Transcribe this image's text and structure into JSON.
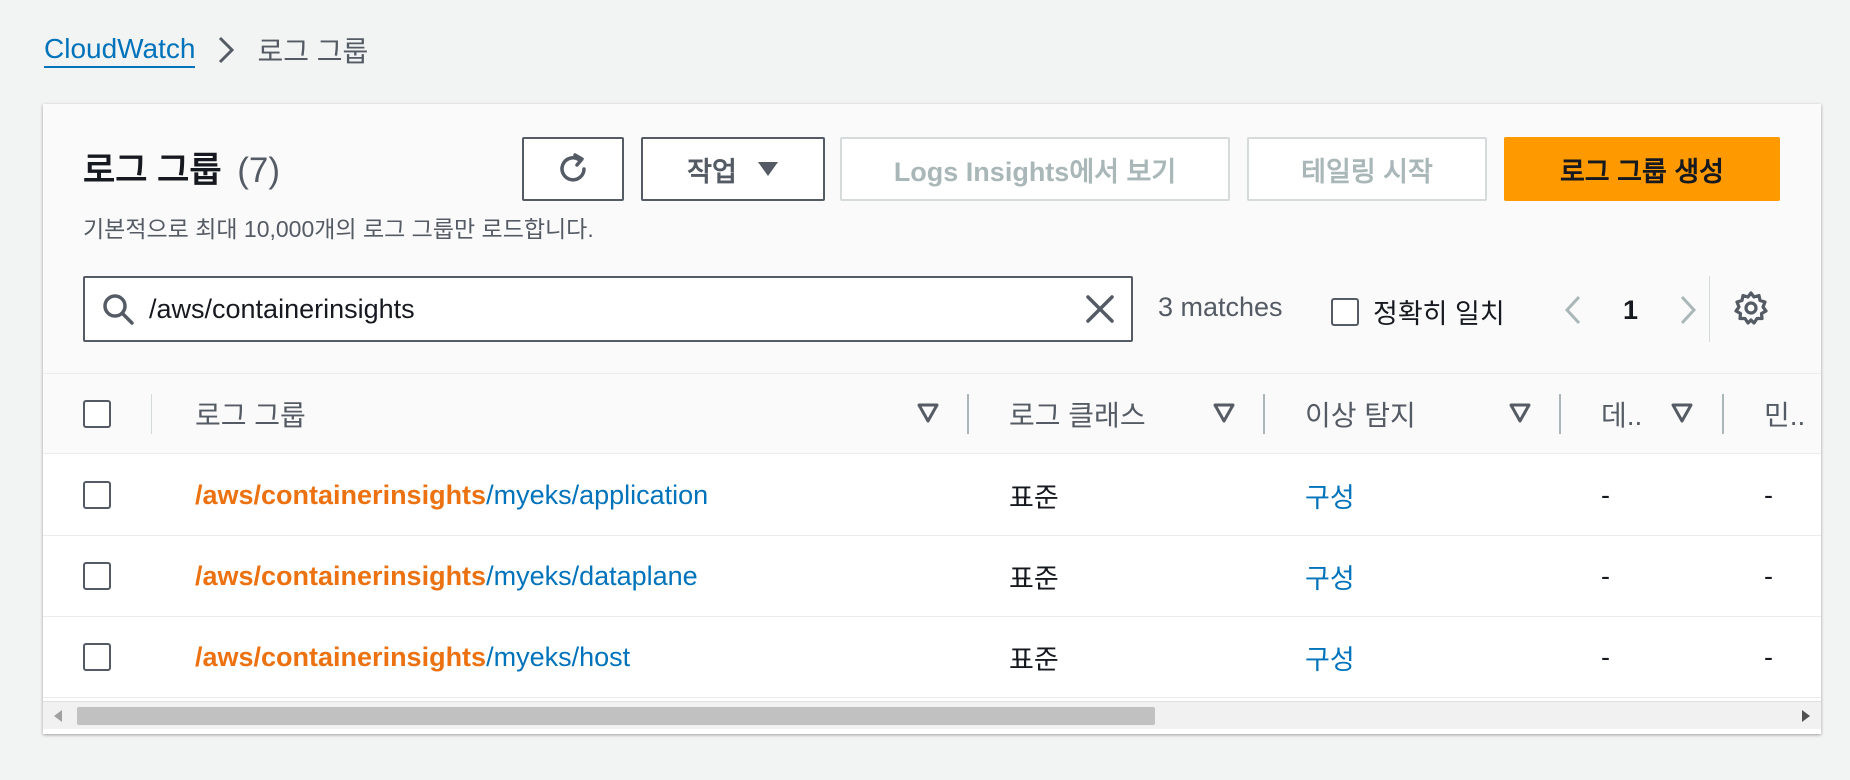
{
  "breadcrumb": {
    "root": "CloudWatch",
    "current": "로그 그룹"
  },
  "header": {
    "title": "로그 그룹",
    "count": "(7)",
    "subtitle": "기본적으로 최대 10,000개의 로그 그룹만 로드합니다."
  },
  "toolbar": {
    "refresh_icon": "refresh-icon",
    "actions_label": "작업",
    "insights_label": "Logs Insights에서 보기",
    "tail_label": "테일링 시작",
    "create_label": "로그 그룹 생성",
    "primary_color": "#ff9900"
  },
  "search": {
    "value": "/aws/containerinsights",
    "matches": "3 matches",
    "exact_match_label": "정확히 일치"
  },
  "pagination": {
    "current_page": "1"
  },
  "table": {
    "columns": [
      "로그 그룹",
      "로그 클래스",
      "이상 탐지",
      "데..",
      "민.."
    ],
    "rows": [
      {
        "highlight": "/aws/containerinsights",
        "rest": "/myeks/application",
        "class": "표준",
        "anomaly": "구성",
        "col4": "-",
        "col5": "-"
      },
      {
        "highlight": "/aws/containerinsights",
        "rest": "/myeks/dataplane",
        "class": "표준",
        "anomaly": "구성",
        "col4": "-",
        "col5": "-"
      },
      {
        "highlight": "/aws/containerinsights",
        "rest": "/myeks/host",
        "class": "표준",
        "anomaly": "구성",
        "col4": "-",
        "col5": "-"
      }
    ],
    "highlight_color": "#ec7211",
    "link_color": "#0073bb"
  },
  "horizontal_scroll": {
    "position_fraction": 0.0
  }
}
